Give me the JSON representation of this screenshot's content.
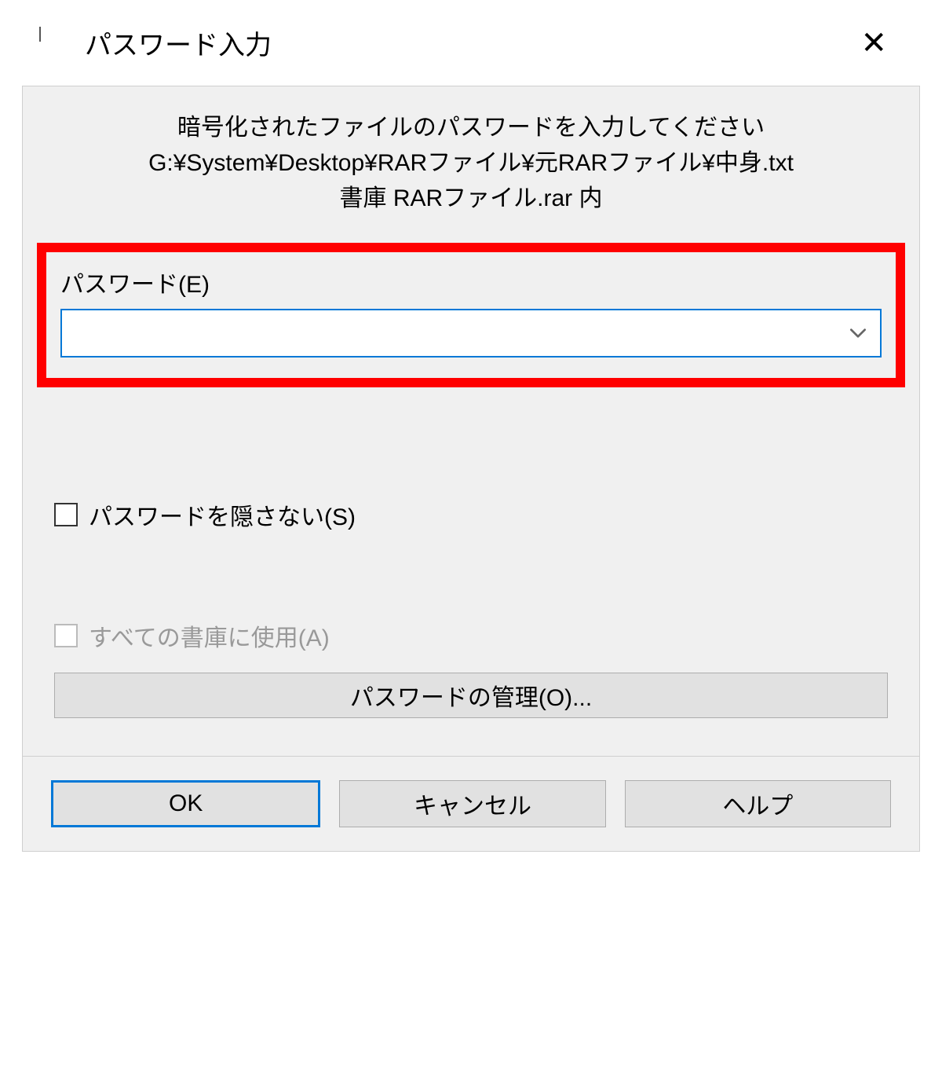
{
  "titlebar": {
    "title": "パスワード入力"
  },
  "instructions": {
    "line1": "暗号化されたファイルのパスワードを入力してください",
    "line2": "G:¥System¥Desktop¥RARファイル¥元RARファイル¥中身.txt",
    "line3": "書庫 RARファイル.rar 内"
  },
  "password": {
    "label": "パスワード(E)",
    "value": ""
  },
  "options": {
    "show_password_label": "パスワードを隠さない(S)",
    "apply_all_label": "すべての書庫に使用(A)"
  },
  "buttons": {
    "manage": "パスワードの管理(O)...",
    "ok": "OK",
    "cancel": "キャンセル",
    "help": "ヘルプ"
  }
}
